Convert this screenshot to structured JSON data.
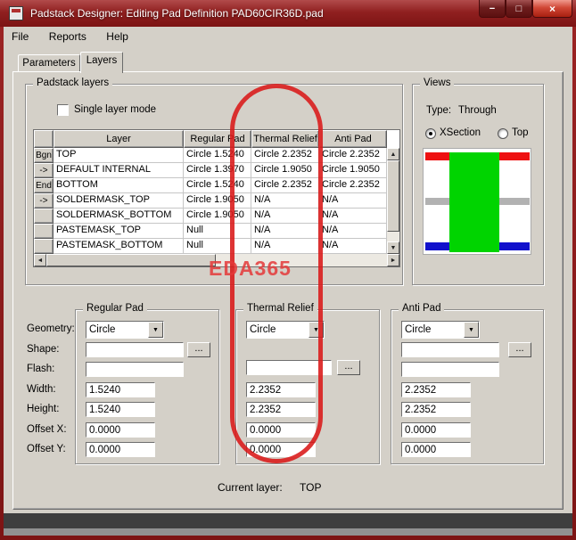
{
  "window": {
    "title": "Padstack Designer: Editing Pad Definition PAD60CIR36D.pad",
    "menu": [
      {
        "label": "File"
      },
      {
        "label": "Reports"
      },
      {
        "label": "Help"
      }
    ],
    "tabs": [
      {
        "label": "Parameters"
      },
      {
        "label": "Layers"
      }
    ]
  },
  "icons": {
    "dropdown": "▼",
    "scroll_up": "▲",
    "scroll_down": "▼",
    "scroll_left": "◄",
    "scroll_right": "►",
    "browse": "...",
    "minimize": "−",
    "maximize": "□",
    "close": "×"
  },
  "padstack": {
    "group_title": "Padstack layers",
    "single_layer_mode": "Single layer mode",
    "columns": {
      "layer": "Layer",
      "regular": "Regular Pad",
      "thermal": "Thermal Relief",
      "anti": "Anti Pad"
    },
    "rows": [
      {
        "marker": "Bgn",
        "layer": "TOP",
        "regular": "Circle 1.5240",
        "thermal": "Circle 2.2352",
        "anti": "Circle 2.2352"
      },
      {
        "marker": "->",
        "layer": "DEFAULT INTERNAL",
        "regular": "Circle 1.3970",
        "thermal": "Circle 1.9050",
        "anti": "Circle 1.9050"
      },
      {
        "marker": "End",
        "layer": "BOTTOM",
        "regular": "Circle 1.5240",
        "thermal": "Circle 2.2352",
        "anti": "Circle 2.2352"
      },
      {
        "marker": "->",
        "layer": "SOLDERMASK_TOP",
        "regular": "Circle 1.9050",
        "thermal": "N/A",
        "anti": "N/A"
      },
      {
        "marker": "",
        "layer": "SOLDERMASK_BOTTOM",
        "regular": "Circle 1.9050",
        "thermal": "N/A",
        "anti": "N/A"
      },
      {
        "marker": "",
        "layer": "PASTEMASK_TOP",
        "regular": "Null",
        "thermal": "N/A",
        "anti": "N/A"
      },
      {
        "marker": "",
        "layer": "PASTEMASK_BOTTOM",
        "regular": "Null",
        "thermal": "N/A",
        "anti": "N/A"
      }
    ]
  },
  "views": {
    "group_title": "Views",
    "type_label": "Type:",
    "type_value": "Through",
    "xsection_label": "XSection",
    "top_label": "Top",
    "colors": {
      "pad": "#00d400",
      "top_layer": "#ee1111",
      "internal": "#b2b2b2",
      "bottom_layer": "#1111cc"
    }
  },
  "labels": {
    "geometry": "Geometry:",
    "shape": "Shape:",
    "flash": "Flash:",
    "width": "Width:",
    "height": "Height:",
    "offset_x": "Offset X:",
    "offset_y": "Offset Y:"
  },
  "regular_pad": {
    "group_title": "Regular Pad",
    "geometry": "Circle",
    "shape": "",
    "flash": "",
    "width": "1.5240",
    "height": "1.5240",
    "offset_x": "0.0000",
    "offset_y": "0.0000"
  },
  "thermal_relief": {
    "group_title": "Thermal Relief",
    "geometry": "Circle",
    "flash": "",
    "width": "2.2352",
    "height": "2.2352",
    "offset_x": "0.0000",
    "offset_y": "0.0000"
  },
  "anti_pad": {
    "group_title": "Anti Pad",
    "geometry": "Circle",
    "shape": "",
    "flash": "",
    "width": "2.2352",
    "height": "2.2352",
    "offset_x": "0.0000",
    "offset_y": "0.0000"
  },
  "footer": {
    "current_layer_label": "Current layer:",
    "current_layer_value": "TOP"
  },
  "annotation": {
    "watermark": "EDA365",
    "highlight_color": "#da1818"
  }
}
